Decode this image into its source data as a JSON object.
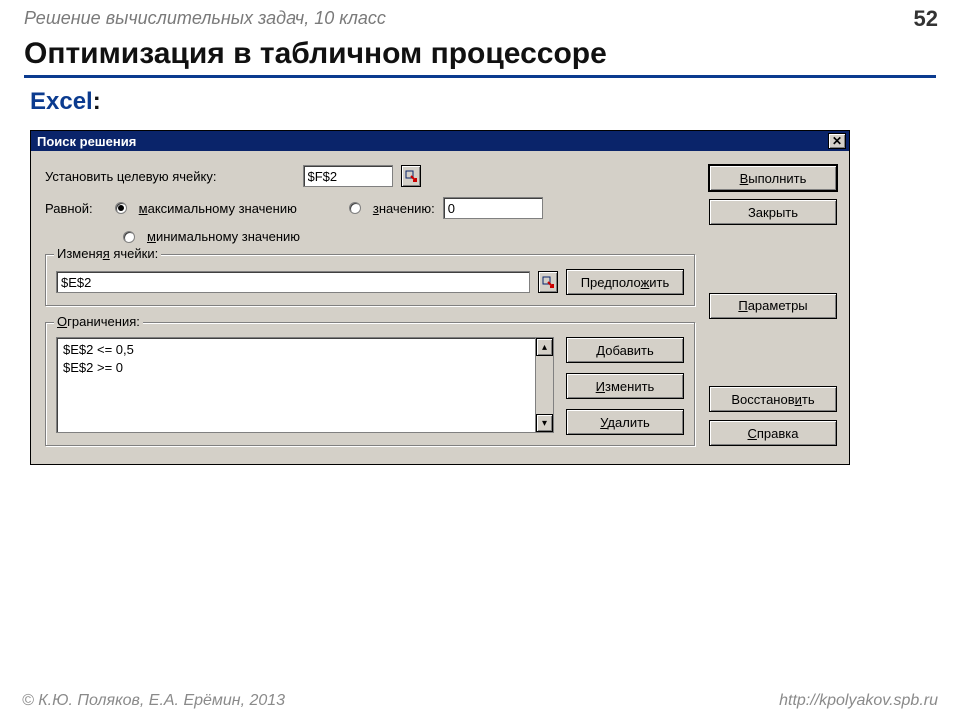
{
  "slide": {
    "header": "Решение  вычислительных задач, 10 класс",
    "page": "52",
    "title": "Оптимизация в табличном процессоре",
    "excel_label": "Excel",
    "footer_left": "© К.Ю. Поляков, Е.А. Ерёмин, 2013",
    "footer_right": "http://kpolyakov.spb.ru"
  },
  "dialog": {
    "title": "Поиск решения",
    "labels": {
      "target_cell": "Установить целевую ячейку:",
      "equal_to": "Равной:",
      "max": "аксимальному значению",
      "max_u": "м",
      "value": "начению:",
      "value_u": "з",
      "min": "инимальному значению",
      "min_u": "м",
      "changing_cells": "Изменя",
      "changing_cells_u": "я",
      "changing_cells_rest": " ячейки:",
      "constraints": "граничения:",
      "constraints_u": "О"
    },
    "fields": {
      "target_cell_value": "$F$2",
      "value_value": "0",
      "changing_cells_value": "$E$2",
      "constraints": [
        "$E$2 <= 0,5",
        "$E$2 >= 0"
      ]
    },
    "buttons": {
      "run": "ыполнить",
      "run_u": "В",
      "close": "Закрыть",
      "guess": "Предполо",
      "guess_u": "ж",
      "guess_rest": "ить",
      "add": "обавить",
      "add_u": "Д",
      "change": "зменить",
      "change_u": "И",
      "delete": "далить",
      "delete_u": "У",
      "options": "араметры",
      "options_u": "П",
      "reset": "Восстанов",
      "reset_u": "и",
      "reset_rest": "ть",
      "help": "правка",
      "help_u": "С"
    }
  }
}
